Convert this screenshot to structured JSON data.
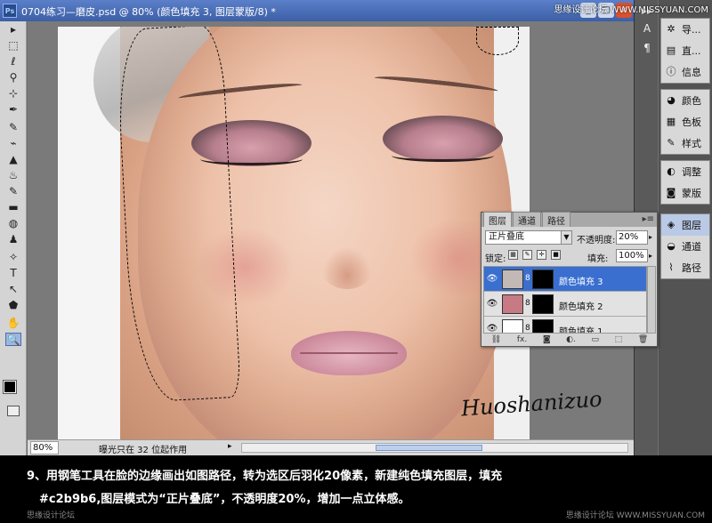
{
  "titlebar": {
    "title": "0704练习—磨皮.psd @ 80% (颜色填充 3, 图层蒙版/8) *",
    "minimize": "_",
    "maximize": "□",
    "close": "x"
  },
  "watermark_top": "思缘设计论坛 WWW.MISSYUAN.COM",
  "tools": [
    "▸",
    "⬚",
    "ℓ",
    "⚲",
    "⊹",
    "✒",
    "✎",
    "⌁",
    "▲",
    "♨",
    "✎",
    "▬",
    "◍",
    "♟",
    "✧",
    "T",
    "↖",
    "⬟",
    "✋",
    "🔍"
  ],
  "statusbar": {
    "zoom": "80%",
    "info": "曝光只在 32 位起作用",
    "arrow": "▸"
  },
  "iconcol": [
    "▸▸",
    "A",
    "¶"
  ],
  "dock": {
    "group1": [
      {
        "icon": "✲",
        "label": "导..."
      },
      {
        "icon": "▤",
        "label": "直..."
      },
      {
        "icon": "ⓘ",
        "label": "信息"
      }
    ],
    "group2": [
      {
        "icon": "◕",
        "label": "颜色"
      },
      {
        "icon": "▦",
        "label": "色板"
      },
      {
        "icon": "✎",
        "label": "样式"
      }
    ],
    "group3": [
      {
        "icon": "◐",
        "label": "调整"
      },
      {
        "icon": "◙",
        "label": "蒙版"
      }
    ],
    "group4": [
      {
        "icon": "◈",
        "label": "图层"
      },
      {
        "icon": "◒",
        "label": "通道"
      },
      {
        "icon": "⌇",
        "label": "路径"
      }
    ]
  },
  "layers_panel": {
    "tabs": [
      "图层",
      "通道",
      "路径"
    ],
    "menu": "▸≡",
    "blend_mode": "正片叠底",
    "opacity_label": "不透明度:",
    "opacity_value": "20%",
    "lock_label": "锁定:",
    "fill_label": "填充:",
    "fill_value": "100%",
    "layers": [
      {
        "name": "颜色填充 3",
        "color": "#c2b9b6",
        "selected": true
      },
      {
        "name": "颜色填充 2",
        "color": "#c77a83",
        "selected": false
      },
      {
        "name": "颜色填充 1",
        "color": "#ffffff",
        "selected": false
      }
    ],
    "bottom_icons": [
      "⛓",
      "fx.",
      "◙",
      "◐.",
      "▭",
      "⬚",
      "🗑"
    ]
  },
  "signature": "Huoshanizuo",
  "caption": {
    "line1": "9、用钢笔工具在脸的边缘画出如图路径，转为选区后羽化20像素，新建纯色填充图层，填充",
    "line2": "#c2b9b6,图层模式为“正片叠底”，不透明度20%，增加一点立体感。",
    "wm_left": "思缘设计论坛",
    "wm_right": "思缘设计论坛 WWW.MISSYUAN.COM"
  }
}
